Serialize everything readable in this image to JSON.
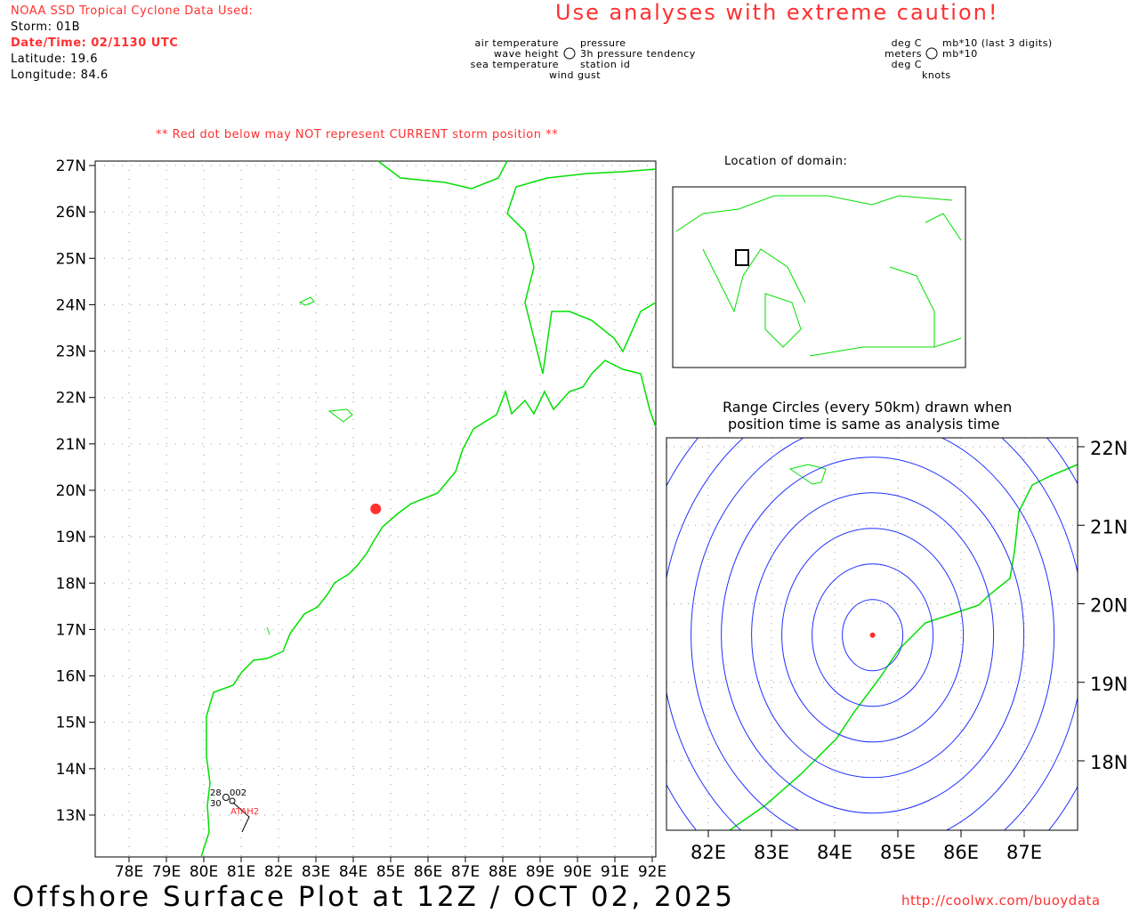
{
  "header": {
    "source": "NOAA SSD Tropical Cyclone Data Used:",
    "storm": "Storm: 01B",
    "datetime": "Date/Time: 02/1130 UTC",
    "latitude": "Latitude: 19.6",
    "longitude": "Longitude: 84.6",
    "caution": "Use analyses with extreme caution!"
  },
  "legend": {
    "left": [
      "air temperature",
      "wave height",
      "sea temperature"
    ],
    "right": [
      "pressure",
      "3h pressure tendency",
      "station id"
    ],
    "bottom": "wind gust",
    "units_left": [
      "deg C",
      "meters",
      "deg C"
    ],
    "units_right": [
      "mb*10 (last 3 digits)",
      "mb*10"
    ],
    "units_bottom": "knots"
  },
  "warning": "** Red dot below may NOT represent CURRENT storm position **",
  "main_map": {
    "lat_labels": [
      "27N",
      "26N",
      "25N",
      "24N",
      "23N",
      "22N",
      "21N",
      "20N",
      "19N",
      "18N",
      "17N",
      "16N",
      "15N",
      "14N",
      "13N"
    ],
    "lon_labels": [
      "78E",
      "79E",
      "80E",
      "81E",
      "82E",
      "83E",
      "84E",
      "85E",
      "86E",
      "87E",
      "88E",
      "89E",
      "90E",
      "91E",
      "92E"
    ],
    "station": {
      "id": "ATAH2",
      "air_temp": "28",
      "sea_temp": "30",
      "pressure": "002"
    },
    "storm_lat": 19.6,
    "storm_lon": 84.6
  },
  "domain_title": "Location of domain:",
  "range": {
    "title1": "Range Circles (every 50km) drawn when",
    "title2": "position time is same as analysis time",
    "lat_labels": [
      "22N",
      "21N",
      "20N",
      "19N",
      "18N"
    ],
    "lon_labels": [
      "82E",
      "83E",
      "84E",
      "85E",
      "86E",
      "87E"
    ]
  },
  "footer": {
    "title": "Offshore Surface Plot at 12Z / OCT 02, 2025",
    "url": "http://coolwx.com/buoydata"
  },
  "colors": {
    "coast": "#00e000",
    "storm": "#ff3030",
    "circles": "#2030ff"
  }
}
